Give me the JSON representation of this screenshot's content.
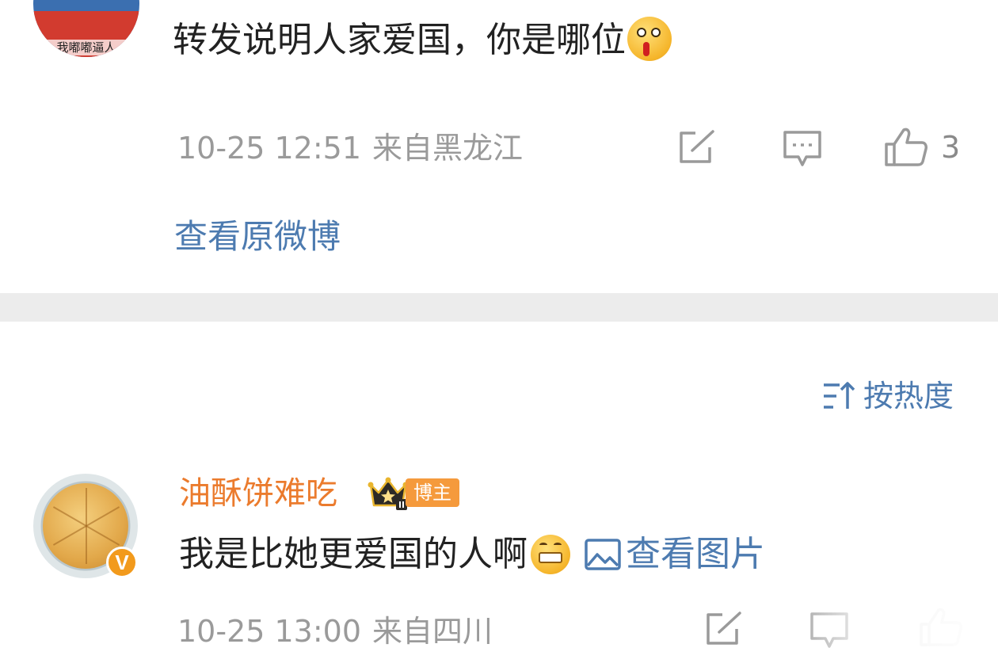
{
  "comment1": {
    "avatar_caption": "我嘟嘟逼人",
    "text": "转发说明人家爱国，你是哪位",
    "emoji": "bleeding-face-emoji",
    "time": "10-25 12:51",
    "location": "来自黑龙江",
    "like_count": "3",
    "view_original": "查看原微博"
  },
  "sort": {
    "label": "按热度",
    "icon": "sort-icon"
  },
  "comment2": {
    "username": "油酥饼难吃",
    "badge_label": "博主",
    "verified_mark": "V",
    "text": "我是比她更爱国的人啊",
    "emoji": "grin-emoji",
    "view_image": "查看图片",
    "time": "10-25 13:00",
    "location": "来自四川"
  },
  "colors": {
    "link": "#4d7bb0",
    "username": "#eb7b2d",
    "meta": "#9a9a9a",
    "badge": "#f59a3c",
    "divider": "#ececec"
  }
}
